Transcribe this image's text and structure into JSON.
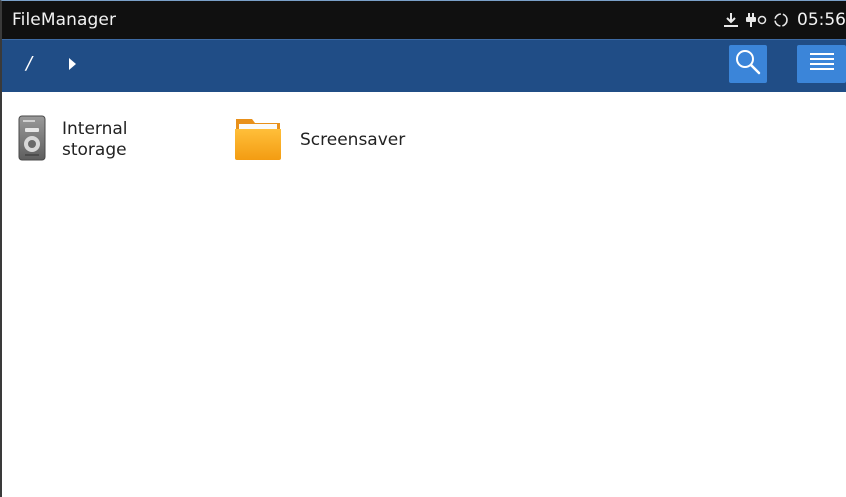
{
  "status_bar": {
    "app_title": "FileManager",
    "time": "05:56",
    "icons": [
      "download-icon",
      "usb-debug-icon",
      "sync-icon"
    ]
  },
  "toolbar": {
    "path_root": "/",
    "search_icon": "search-icon",
    "menu_icon": "menu-icon"
  },
  "files": {
    "items": [
      {
        "label": "Internal storage",
        "icon": "storage-drive-icon"
      },
      {
        "label": "Screensaver",
        "icon": "folder-icon"
      }
    ]
  },
  "colors": {
    "status_bar_bg": "#101010",
    "toolbar_bg": "#204d86",
    "toolbar_button": "#3b85d9",
    "folder": "#f5a623",
    "content_bg": "#ffffff"
  }
}
